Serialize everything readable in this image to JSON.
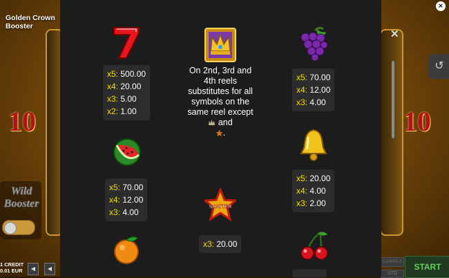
{
  "game": {
    "title": "Golden Crown Booster",
    "left_value": "10",
    "right_value": "10",
    "wild_booster": "Wild Booster",
    "credit_line1": "1 CREDIT",
    "credit_line2": "0.01 EUR",
    "start_label": "START",
    "gamble_label": "GAMBLE",
    "std_label": "STD",
    "close_icon": "close-icon",
    "history_icon": "history-icon"
  },
  "paytable": {
    "seven": {
      "icon": "seven-icon",
      "rows": [
        {
          "mult": "x5:",
          "amt": "500.00"
        },
        {
          "mult": "x4:",
          "amt": "20.00"
        },
        {
          "mult": "x3:",
          "amt": "5.00"
        },
        {
          "mult": "x2:",
          "amt": "1.00"
        }
      ]
    },
    "wild": {
      "icon": "crown-icon",
      "description": "On 2nd, 3rd and 4th reels substitutes for all symbols on the same reel except",
      "and": "and"
    },
    "grapes": {
      "icon": "grapes-icon",
      "rows": [
        {
          "mult": "x5:",
          "amt": "70.00"
        },
        {
          "mult": "x4:",
          "amt": "12.00"
        },
        {
          "mult": "x3:",
          "amt": "4.00"
        }
      ]
    },
    "watermelon": {
      "icon": "watermelon-icon",
      "rows": [
        {
          "mult": "x5:",
          "amt": "70.00"
        },
        {
          "mult": "x4:",
          "amt": "12.00"
        },
        {
          "mult": "x3:",
          "amt": "4.00"
        }
      ]
    },
    "bell": {
      "icon": "bell-icon",
      "rows": [
        {
          "mult": "x5:",
          "amt": "20.00"
        },
        {
          "mult": "x4:",
          "amt": "4.00"
        },
        {
          "mult": "x3:",
          "amt": "2.00"
        }
      ]
    },
    "scatter": {
      "icon": "scatter-star-icon",
      "label": "SCATTER",
      "rows": [
        {
          "mult": "x3:",
          "amt": "20.00"
        }
      ]
    },
    "orange": {
      "icon": "orange-icon"
    },
    "cherries": {
      "icon": "cherries-icon"
    }
  }
}
